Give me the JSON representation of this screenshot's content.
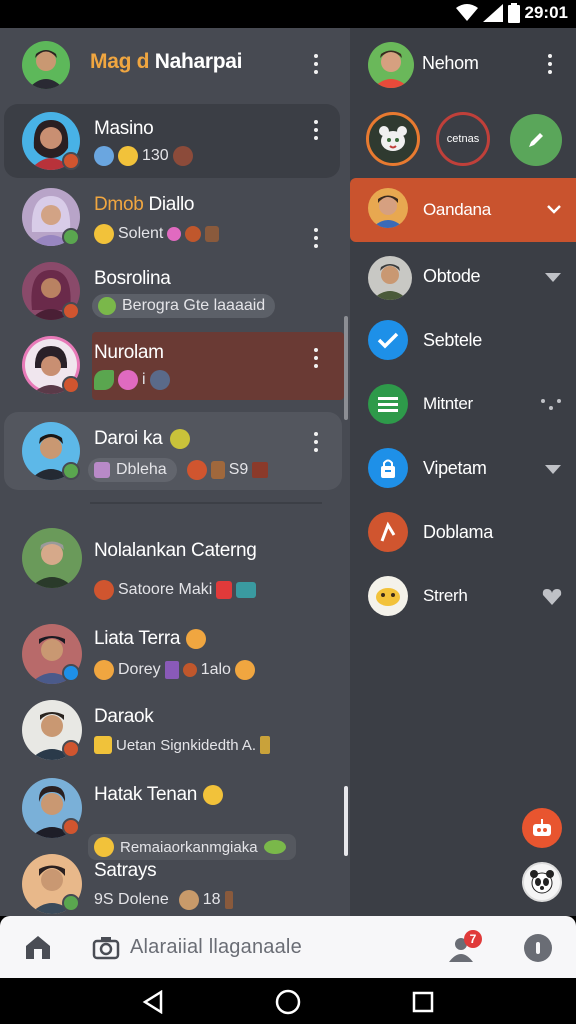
{
  "status_bar": {
    "time": "29:01"
  },
  "left_header": {
    "title_accent": "Mag d",
    "title_rest": " Naharpai"
  },
  "chats": [
    {
      "name": "Masino",
      "preview": "130",
      "selected": true
    },
    {
      "name_accent": "Dmob",
      "name_rest": " Diallo",
      "preview": "Solent"
    },
    {
      "name": "Bosrolina",
      "preview": "Berogra Gte laaaaid"
    },
    {
      "name": "Nurolam",
      "preview": "i"
    },
    {
      "name": "Daroi ka",
      "preview": "Dbleha",
      "preview_suffix": "S9"
    },
    {
      "name": "Nolalankan Caterng",
      "preview": "Satoore Maki"
    },
    {
      "name": "Liata Terra",
      "preview": "Dorey",
      "preview_suffix": "1alo"
    },
    {
      "name": "Daraok",
      "preview": "Uetan Signkidedth A."
    },
    {
      "name": "Hatak Tenan",
      "preview": "Remaiaorkanmgiaka"
    },
    {
      "name": "Satrays",
      "preview": "9S Dolene",
      "preview_suffix": "18"
    }
  ],
  "right_panel": {
    "header_name": "Nehom",
    "quick_actions": [
      {
        "icon": "group-icon",
        "label": ""
      },
      {
        "icon": "ring-icon",
        "label": "cetnas"
      },
      {
        "icon": "pencil-icon",
        "label": ""
      }
    ],
    "items": [
      {
        "label": "Oandana",
        "icon": "avatar-icon",
        "active": true
      },
      {
        "label": "Obtode",
        "icon": "avatar-icon"
      },
      {
        "label": "Sebtele",
        "icon": "check-icon"
      },
      {
        "label": "Mitnter",
        "icon": "list-icon"
      },
      {
        "label": "Vipetam",
        "icon": "lock-icon"
      },
      {
        "label": "Doblama",
        "icon": "tool-icon"
      },
      {
        "label": "Strerh",
        "icon": "emoji-icon"
      }
    ]
  },
  "bottom_bar": {
    "search_placeholder": "Alaraiial llaganaale",
    "notification_count": "7"
  },
  "colors": {
    "accent_orange": "#d0552f",
    "selected_row": "#6a3a34",
    "green": "#5aa64f",
    "blue": "#1e90e8"
  }
}
